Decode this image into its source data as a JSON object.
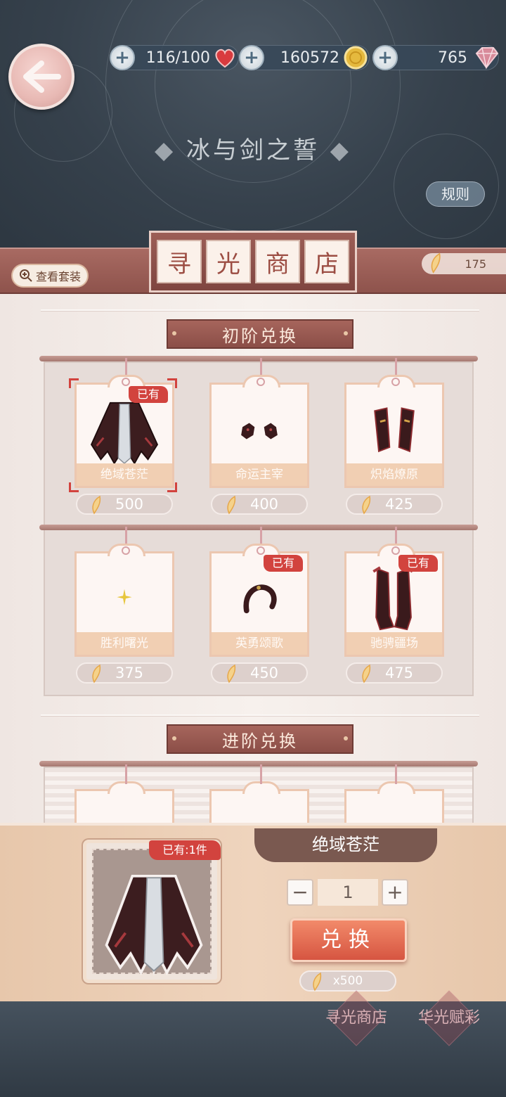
{
  "header": {
    "stamina": "116/100",
    "gold": "160572",
    "gems": "765",
    "event_title": "冰与剑之誓",
    "rules_label": "规则"
  },
  "shop": {
    "title_chars": [
      "寻",
      "光",
      "商",
      "店"
    ],
    "view_suit_label": "查看套装",
    "currency_amount": "175"
  },
  "sections": {
    "basic_label": "初阶兑换",
    "advanced_label": "进阶兑换"
  },
  "items": [
    {
      "name": "绝域苍茫",
      "price": "500",
      "owned_label": "已有",
      "owned": true,
      "selected": true
    },
    {
      "name": "命运主宰",
      "price": "400",
      "owned": false
    },
    {
      "name": "炽焰燎原",
      "price": "425",
      "owned": false
    },
    {
      "name": "胜利曙光",
      "price": "375",
      "owned": false
    },
    {
      "name": "英勇颂歌",
      "price": "450",
      "owned_label": "已有",
      "owned": true
    },
    {
      "name": "驰骋疆场",
      "price": "475",
      "owned_label": "已有",
      "owned": true
    }
  ],
  "detail": {
    "owned_count": "已有:1件",
    "item_name": "绝域苍茫",
    "quantity": "1",
    "minus_label": "−",
    "plus_label": "+",
    "exchange_label": "兑换",
    "cost": "x500"
  },
  "footer": {
    "tab1": "寻光商店",
    "tab2": "华光赋彩"
  },
  "colors": {
    "accent_red": "#d2433e",
    "wood": "#8e534c",
    "panel": "#efd4bd"
  }
}
